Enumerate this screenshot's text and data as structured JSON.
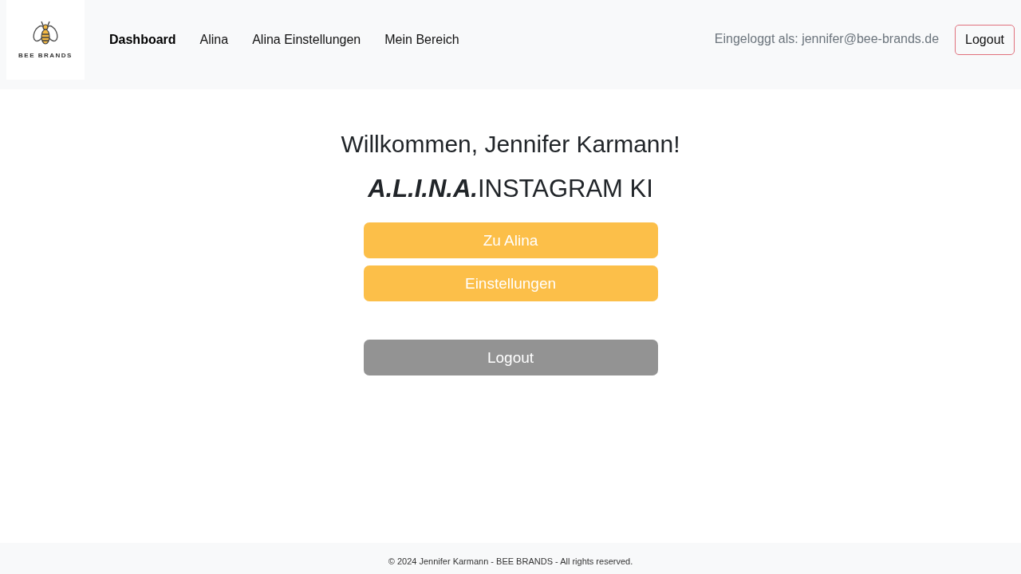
{
  "header": {
    "logo": {
      "text": "BEE BRANDS"
    },
    "nav": [
      {
        "label": "Dashboard",
        "selected": true
      },
      {
        "label": "Alina",
        "selected": false
      },
      {
        "label": "Alina Einstellungen",
        "selected": false
      },
      {
        "label": "Mein Bereich",
        "selected": false
      }
    ],
    "user_info": "Eingeloggt als: jennifer@bee-brands.de",
    "logout_button": "Logout"
  },
  "main": {
    "greeting": "Willkommen, Jennifer Karmann!",
    "title": "**A.L.I.N.A.**INSTAGRAM KI",
    "buttons": [
      {
        "label": "Zu Alina",
        "kind": "primary"
      },
      {
        "label": "Einstellungen",
        "kind": "primary"
      },
      {
        "label": "Logout",
        "kind": "secondary"
      }
    ]
  },
  "footer": {
    "text": "© 2024 Jennifer Karmann - BEE BRANDS - All rights reserved."
  }
}
